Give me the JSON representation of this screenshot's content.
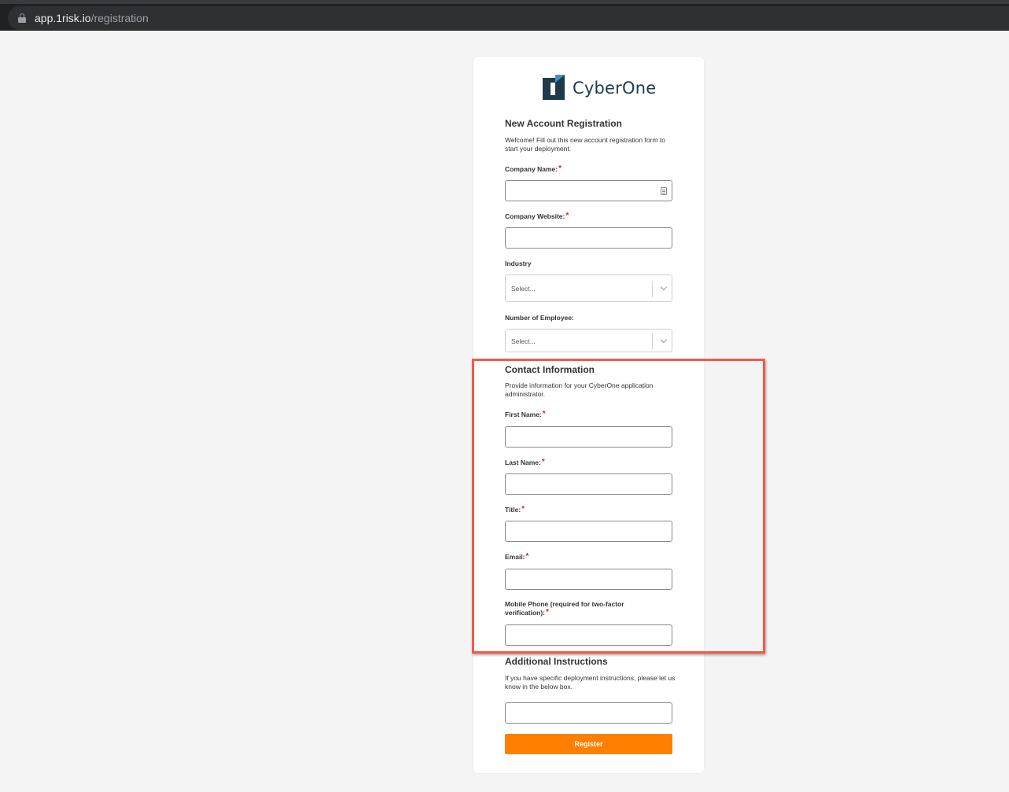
{
  "browser": {
    "url_host": "app.1risk.io",
    "url_path": "/registration"
  },
  "logo": {
    "text": "CyberOne",
    "color": "#1f3a4a"
  },
  "form": {
    "title": "New Account Registration",
    "description": "Welcome! Fill out this new account registration form to start your deployment.",
    "company_name_label": "Company Name:",
    "company_website_label": "Company Website:",
    "industry_label": "Industry",
    "industry_placeholder": "Select...",
    "employees_label": "Number of Employee:",
    "employees_placeholder": "Select...",
    "required_marker": "*"
  },
  "contact": {
    "title": "Contact Information",
    "description": "Provide information for your CyberOne application administrator.",
    "first_name_label": "First Name:",
    "last_name_label": "Last Name:",
    "title_label": "Title:",
    "email_label": "Email:",
    "mobile_label": "Mobile Phone (required for two-factor verification):"
  },
  "additional": {
    "title": "Additional Instructions",
    "description": "If you have specific deployment instructions, please let us know in the below box."
  },
  "register_label": "Register",
  "colors": {
    "accent": "#ff7f00",
    "required": "#e02020",
    "highlight": "#f25a4a"
  }
}
